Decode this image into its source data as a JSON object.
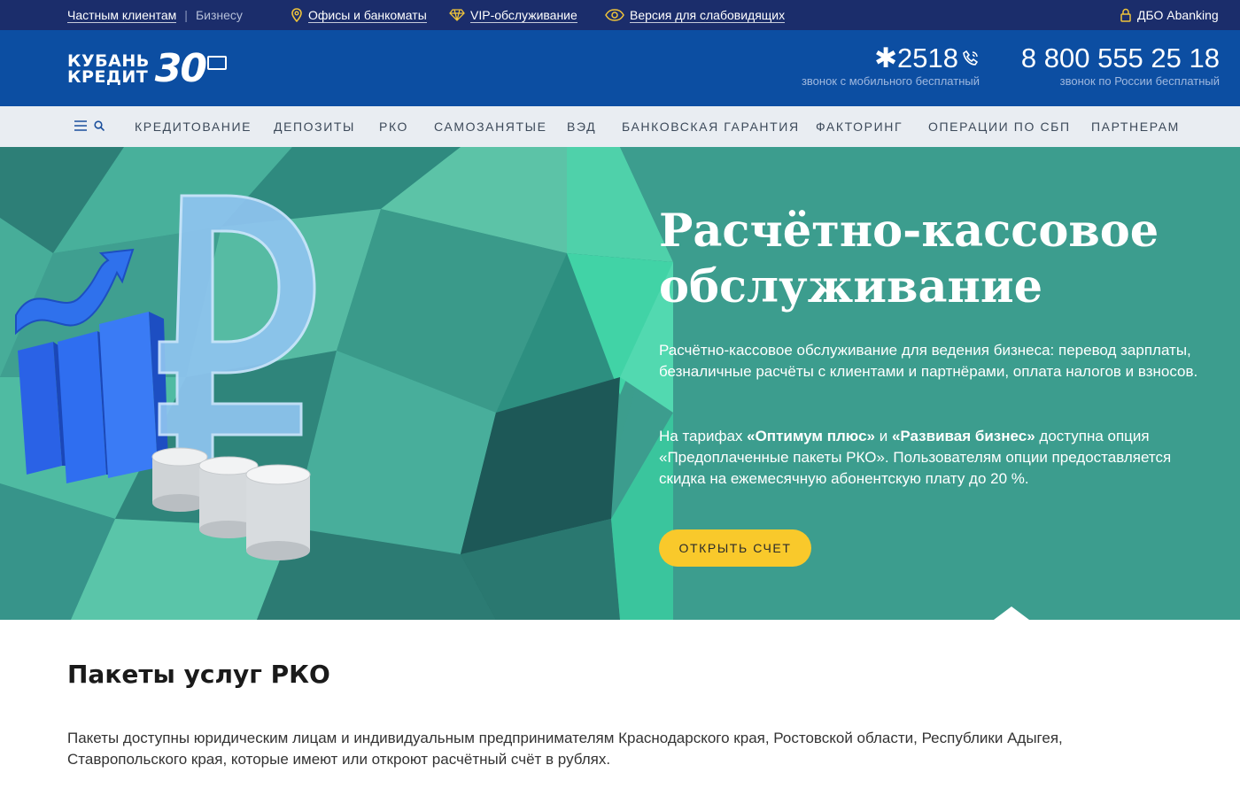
{
  "topbar": {
    "private_clients": "Частным клиентам",
    "separator": "|",
    "business": "Бизнесу",
    "offices": "Офисы и банкоматы",
    "vip": "VIP-обслуживание",
    "accessibility": "Версия для слабовидящих",
    "dbo": "ДБО Abanking"
  },
  "header": {
    "logo": {
      "line1": "КУБАНЬ",
      "line2": "КРЕДИТ",
      "number": "30"
    },
    "short_phone": {
      "number": "✱2518",
      "note": "звонок с мобильного бесплатный"
    },
    "long_phone": {
      "number": "8 800 555 25 18",
      "note": "звонок по России бесплатный"
    }
  },
  "nav": {
    "items": [
      "КРЕДИТОВАНИЕ",
      "ДЕПОЗИТЫ",
      "РКО",
      "САМОЗАНЯТЫЕ",
      "ВЭД",
      "БАНКОВСКАЯ ГАРАНТИЯ",
      "ФАКТОРИНГ",
      "ОПЕРАЦИИ ПО СБП",
      "ПАРТНЕРАМ"
    ]
  },
  "hero": {
    "title_line1": "Расчётно-кассовое",
    "title_line2": "обслуживание",
    "paragraph1": "Расчётно-кассовое обслуживание для ведения бизнеса: перевод зарплаты, безналичные расчёты с клиентами и партнёрами, оплата налогов и взносов.",
    "p2_part1": "На тарифах ",
    "p2_bold1": "«Оптимум плюс»",
    "p2_part2": " и ",
    "p2_bold2": "«Развивая бизнес»",
    "p2_part3": " доступна опция «Предоплаченные пакеты РКО». Пользователям опции предоставляется скидка на ежемесячную абонентскую плату до 20 %.",
    "cta": "ОТКРЫТЬ СЧЕТ"
  },
  "content": {
    "title": "Пакеты услуг РКО",
    "paragraph": "Пакеты доступны юридическим лицам и индивидуальным предпринимателям Краснодарского края, Ростовской области, Республики Адыгея, Ставропольского края, которые имеют или откроют расчётный счёт в рублях."
  },
  "colors": {
    "topbar": "#1b2d6b",
    "header": "#0c4ea2",
    "nav": "#e9edf2",
    "hero": "#3a9a8c",
    "cta": "#f9c92b"
  }
}
